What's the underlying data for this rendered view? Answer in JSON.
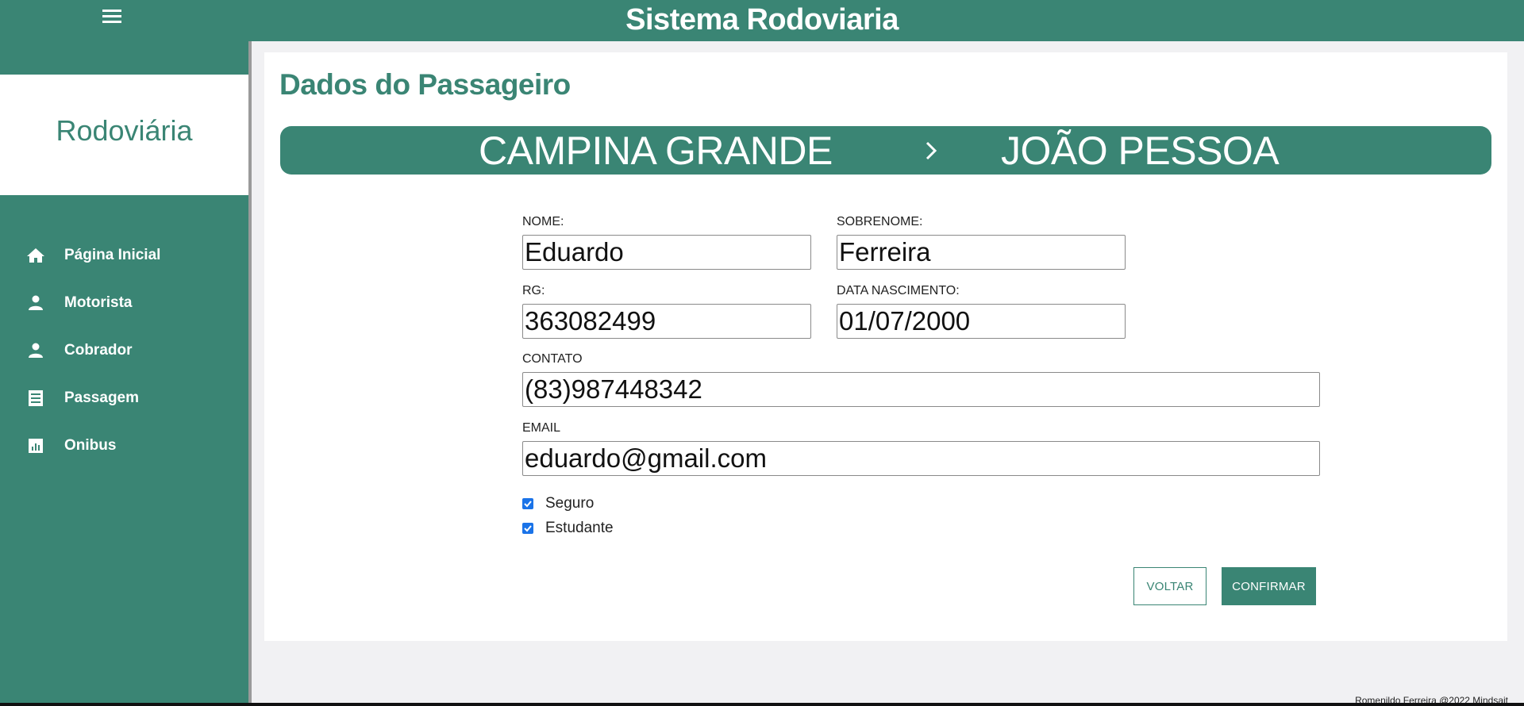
{
  "header": {
    "title": "Sistema Rodoviaria",
    "menu_icon": "menu-icon"
  },
  "sidebar": {
    "brand": "Rodoviária",
    "items": [
      {
        "label": "Página Inicial",
        "icon": "home-icon"
      },
      {
        "label": "Motorista",
        "icon": "person-icon"
      },
      {
        "label": "Cobrador",
        "icon": "person-icon"
      },
      {
        "label": "Passagem",
        "icon": "receipt-icon"
      },
      {
        "label": "Onibus",
        "icon": "chart-icon"
      }
    ]
  },
  "main": {
    "title": "Dados do Passageiro",
    "route": {
      "from": "CAMPINA GRANDE",
      "to": "JOÃO PESSOA",
      "arrow_icon": "chevron-right-icon"
    },
    "form": {
      "nome_label": "NOME:",
      "nome_value": "Eduardo",
      "sobrenome_label": "SOBRENOME:",
      "sobrenome_value": "Ferreira",
      "rg_label": "RG:",
      "rg_value": "363082499",
      "nascimento_label": "DATA NASCIMENTO:",
      "nascimento_value": "01/07/2000",
      "contato_label": "CONTATO",
      "contato_value": "(83)987448342",
      "email_label": "EMAIL",
      "email_value": "eduardo@gmail.com",
      "seguro_label": "Seguro",
      "seguro_checked": true,
      "estudante_label": "Estudante",
      "estudante_checked": true
    },
    "buttons": {
      "back": "VOLTAR",
      "confirm": "CONFIRMAR"
    }
  },
  "footer": {
    "text": "Romenildo Ferreira @2022 Mindsait"
  },
  "colors": {
    "primary": "#3a8574",
    "checkbox": "#1a73e8"
  }
}
